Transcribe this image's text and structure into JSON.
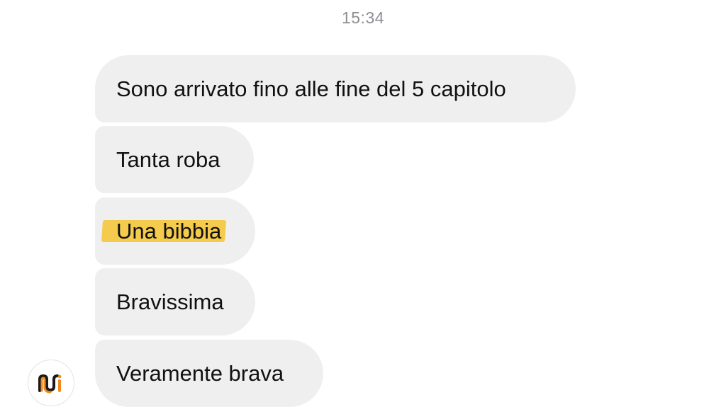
{
  "timestamp": "15:34",
  "messages": [
    {
      "text": "Sono arrivato fino alle fine del 5 capitolo"
    },
    {
      "text": "Tanta roba"
    },
    {
      "text": "Una bibbia",
      "highlighted": true,
      "highlight_color": "#f4c430"
    },
    {
      "text": "Bravissima"
    },
    {
      "text": "Veramente brava"
    }
  ],
  "colors": {
    "bubble_background": "#efefef",
    "timestamp": "#8e8e93",
    "text": "#111111",
    "avatar_logo_orange": "#f08a1e",
    "avatar_logo_dark": "#1a1a1a"
  },
  "avatar": {
    "icon": "brand-logo-icon"
  }
}
